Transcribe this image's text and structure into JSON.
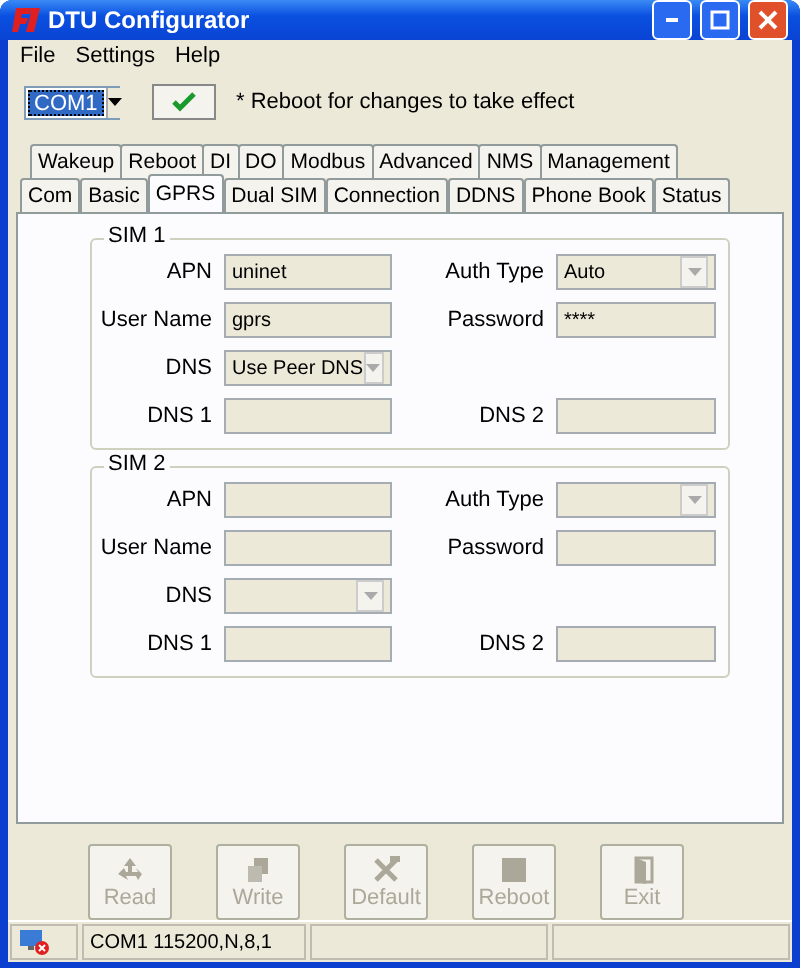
{
  "window": {
    "title": "DTU Configurator"
  },
  "menu": [
    "File",
    "Settings",
    "Help"
  ],
  "toolbar": {
    "port": "COM1",
    "note": "* Reboot for changes to take effect"
  },
  "tab_rows": [
    [
      {
        "label": "Wakeup",
        "selected": false
      },
      {
        "label": "Reboot",
        "selected": false
      },
      {
        "label": "DI",
        "selected": false
      },
      {
        "label": "DO",
        "selected": false
      },
      {
        "label": "Modbus",
        "selected": false
      },
      {
        "label": "Advanced",
        "selected": false
      },
      {
        "label": "NMS",
        "selected": false
      },
      {
        "label": "Management",
        "selected": false
      }
    ],
    [
      {
        "label": "Com",
        "selected": false
      },
      {
        "label": "Basic",
        "selected": false
      },
      {
        "label": "GPRS",
        "selected": true
      },
      {
        "label": "Dual SIM",
        "selected": false
      },
      {
        "label": "Connection",
        "selected": false
      },
      {
        "label": "DDNS",
        "selected": false
      },
      {
        "label": "Phone Book",
        "selected": false
      },
      {
        "label": "Status",
        "selected": false
      }
    ]
  ],
  "sections": [
    {
      "title": "SIM 1",
      "rows": [
        [
          {
            "label": "APN",
            "kind": "text",
            "value": "uninet"
          },
          {
            "label": "Auth Type",
            "kind": "select",
            "value": "Auto"
          }
        ],
        [
          {
            "label": "User Name",
            "kind": "text",
            "value": "gprs"
          },
          {
            "label": "Password",
            "kind": "text",
            "value": "****"
          }
        ],
        [
          {
            "label": "DNS",
            "kind": "select",
            "value": "Use Peer DNS"
          }
        ],
        [
          {
            "label": "DNS 1",
            "kind": "text"
          },
          {
            "label": "DNS 2",
            "kind": "text"
          }
        ]
      ]
    },
    {
      "title": "SIM 2",
      "rows": [
        [
          {
            "label": "APN",
            "kind": "text"
          },
          {
            "label": "Auth Type",
            "kind": "select"
          }
        ],
        [
          {
            "label": "User Name",
            "kind": "text"
          },
          {
            "label": "Password",
            "kind": "text"
          }
        ],
        [
          {
            "label": "DNS",
            "kind": "select"
          }
        ],
        [
          {
            "label": "DNS 1",
            "kind": "text"
          },
          {
            "label": "DNS 2",
            "kind": "text"
          }
        ]
      ]
    }
  ],
  "buttons": [
    {
      "label": "Read",
      "disabled": true
    },
    {
      "label": "Write",
      "disabled": true
    },
    {
      "label": "Default",
      "disabled": true
    },
    {
      "label": "Reboot",
      "disabled": true
    },
    {
      "label": "Exit",
      "disabled": true
    }
  ],
  "status_bar": {
    "port_settings": "COM1 115200,N,8,1"
  }
}
